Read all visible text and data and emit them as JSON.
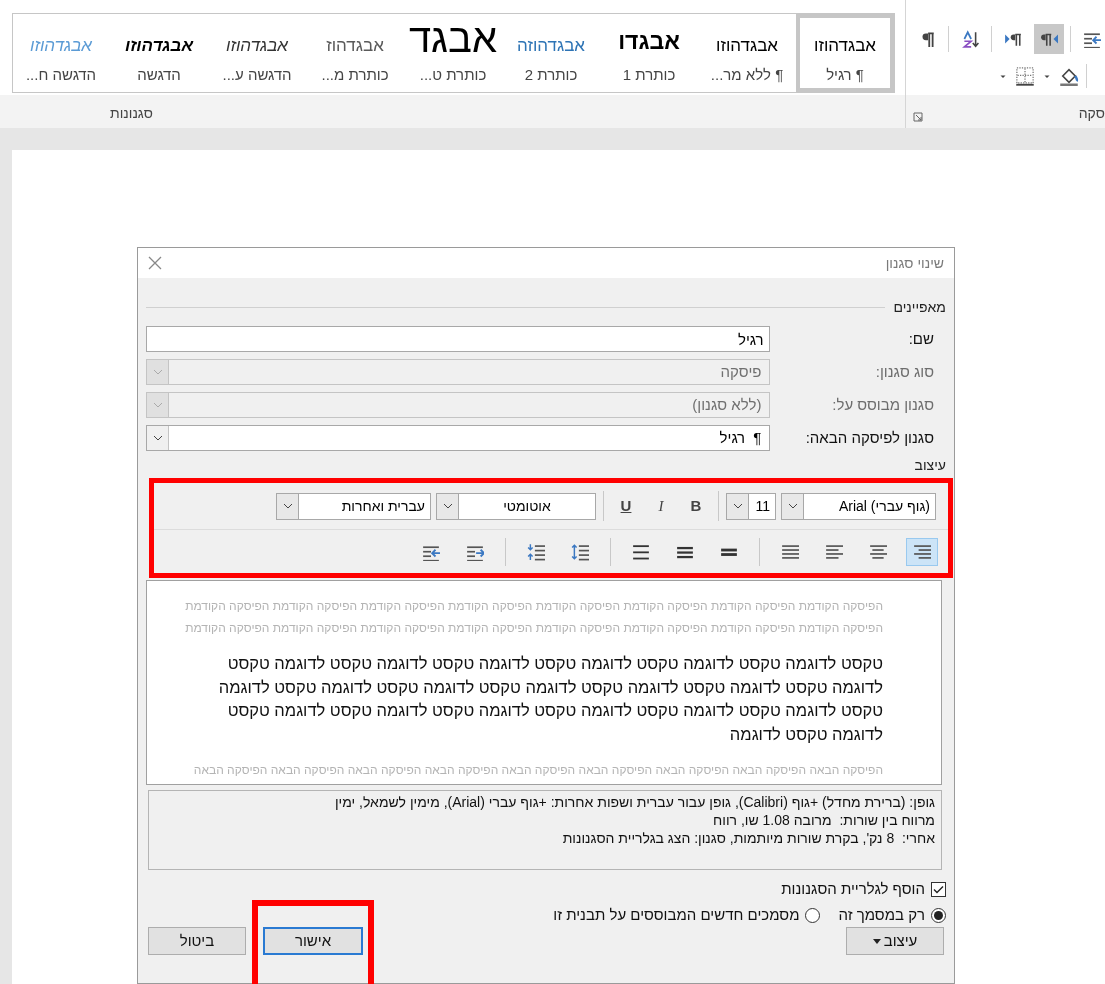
{
  "ribbon": {
    "styles_group": {
      "label": "סגנונות",
      "gallery": [
        {
          "sample": "אבגדהוזו",
          "name": "¶ רגיל",
          "kind": "normal",
          "selected": true
        },
        {
          "sample": "אבגדהוזו",
          "name": "¶ ללא מר...",
          "kind": "normal",
          "selected": false
        },
        {
          "sample": "אבגדו",
          "name": "כותרת 1",
          "kind": "heading1",
          "selected": false
        },
        {
          "sample": "אבגדהוזה",
          "name": "כותרת 2",
          "kind": "heading2",
          "selected": false
        },
        {
          "sample": "אבגד",
          "name": "כותרת ט...",
          "kind": "title",
          "selected": false
        },
        {
          "sample": "אבגדהוז",
          "name": "כותרת מ...",
          "kind": "subtitle",
          "selected": false
        },
        {
          "sample": "אבגדהוזו",
          "name": "הדגשה ע...",
          "kind": "italic",
          "selected": false
        },
        {
          "sample": "אבגדהוזו",
          "name": "הדגשה",
          "kind": "bolditalic",
          "selected": false
        },
        {
          "sample": "אבגדהוזו",
          "name": "הדגשה ח...",
          "kind": "intense",
          "selected": false
        }
      ]
    },
    "paragraph_group": {
      "label": "סקה",
      "tools": [
        {
          "kind": "pilcrow",
          "selected": false
        },
        {
          "kind": "sort",
          "selected": false
        },
        {
          "kind": "ltr",
          "selected": false
        },
        {
          "kind": "rtl",
          "selected": true
        },
        {
          "kind": "indent",
          "selected": false
        }
      ],
      "tools_row2": [
        {
          "kind": "caret"
        },
        {
          "kind": "borders"
        },
        {
          "kind": "caret"
        },
        {
          "kind": "shading"
        }
      ]
    }
  },
  "dialog": {
    "title": "שינוי סגנון",
    "properties_label": "מאפיינים",
    "fields": [
      {
        "label": "שם:",
        "value": "רגיל",
        "kind": "text",
        "disabled": false
      },
      {
        "label": "סוג סגנון:",
        "value": "פיסקה",
        "kind": "select",
        "disabled": true
      },
      {
        "label": "סגנון מבוסס על:",
        "value": "(ללא סגנון)",
        "kind": "select",
        "disabled": true
      },
      {
        "label": "סגנון לפיסקה הבאה:",
        "value": "¶  רגיל",
        "kind": "select",
        "disabled": false
      }
    ],
    "formatting_label": "עיצוב",
    "format_toolbar": {
      "highlighted": true,
      "font": "(גוף עברי) Arial",
      "size": "11",
      "bold": "B",
      "italic": "I",
      "underline": "U",
      "font_color_setting": "אוטומטי",
      "language": "עברית ואחרות",
      "tool_groups": [
        [
          {
            "kind": "align-right",
            "selected": true
          },
          {
            "kind": "align-center",
            "selected": false
          },
          {
            "kind": "align-left",
            "selected": false
          },
          {
            "kind": "justify",
            "selected": false
          }
        ],
        [
          {
            "kind": "spacing-single",
            "selected": false
          },
          {
            "kind": "spacing-onehalf",
            "selected": false
          },
          {
            "kind": "spacing-double",
            "selected": false
          }
        ],
        [
          {
            "kind": "space-increase",
            "selected": false
          },
          {
            "kind": "space-decrease",
            "selected": false
          }
        ],
        [
          {
            "kind": "outdent",
            "selected": false
          },
          {
            "kind": "indent",
            "selected": false
          }
        ]
      ]
    },
    "preview": {
      "previous_lines": [
        "הפיסקה הקודמת הפיסקה הקודמת הפיסקה הקודמת הפיסקה הקודמת הפיסקה הקודמת הפיסקה הקודמת הפיסקה הקודמת הפיסקה הקודמת",
        "הפיסקה הקודמת הפיסקה הקודמת הפיסקה הקודמת הפיסקה הקודמת הפיסקה הקודמת הפיסקה הקודמת הפיסקה הקודמת הפיסקה הקודמת"
      ],
      "sample_lines": [
        "טקסט לדוגמה טקסט לדוגמה טקסט לדוגמה טקסט לדוגמה טקסט לדוגמה טקסט לדוגמה טקסט",
        "לדוגמה טקסט לדוגמה טקסט לדוגמה טקסט לדוגמה טקסט לדוגמה טקסט לדוגמה טקסט לדוגמה",
        "טקסט לדוגמה טקסט לדוגמה טקסט לדוגמה טקסט לדוגמה טקסט לדוגמה טקסט לדוגמה טקסט",
        "לדוגמה טקסט לדוגמה"
      ],
      "next_lines": [
        "הפיסקה הבאה הפיסקה הבאה הפיסקה הבאה הפיסקה הבאה הפיסקה הבאה הפיסקה הבאה הפיסקה הבאה הפיסקה הבאה הפיסקה הבאה"
      ]
    },
    "description_lines": [
      "גופן: (ברירת מחדל) +גוף (Calibri), גופן עבור עברית ושפות אחרות: +גוף עברי (Arial), מימין לשמאל, ימין",
      "מרווח בין שורות:  מרובה 1.08 שו, רווח",
      "אחרי:  8 נק', בקרת שורות מיותמות, סגנון: הצג בגלריית הסגנונות"
    ],
    "add_to_gallery": {
      "label": "הוסף לגלריית הסגנונות",
      "checked": true
    },
    "scope_options": [
      {
        "label": "רק במסמך זה",
        "selected": true
      },
      {
        "label": "מסמכים חדשים המבוססים על תבנית זו",
        "selected": false
      }
    ],
    "buttons": [
      {
        "label": "עיצוב",
        "kind": "menu",
        "highlighted": false
      },
      {
        "label": "אישור",
        "kind": "default",
        "highlighted": true
      },
      {
        "label": "ביטול",
        "kind": "normal",
        "highlighted": false
      }
    ]
  }
}
